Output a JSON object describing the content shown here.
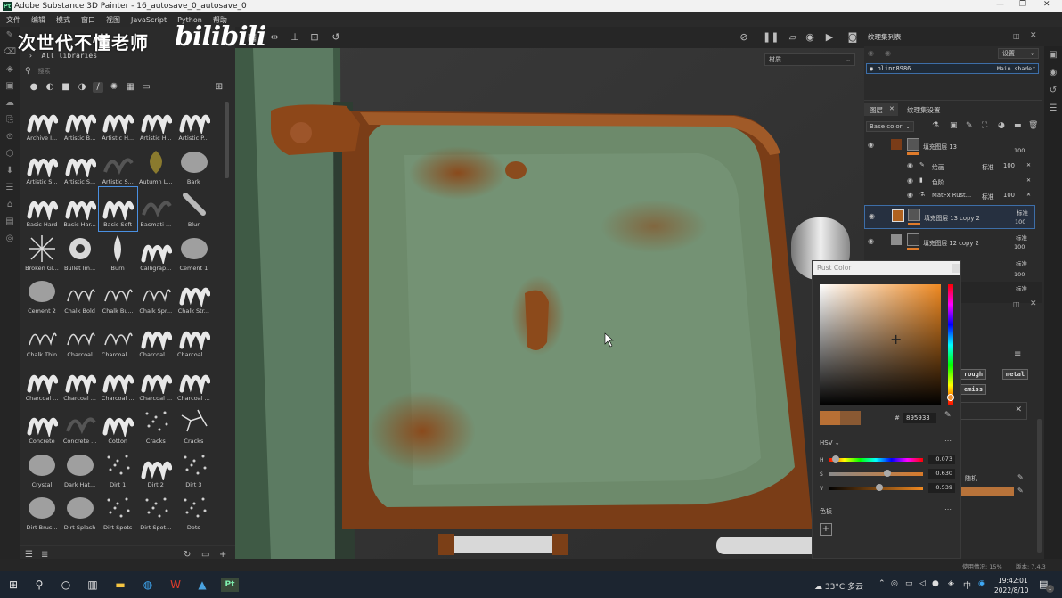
{
  "titlebar": {
    "app_icon": "Pt",
    "title": "Adobe Substance 3D Painter - 16_autosave_0_autosave_0"
  },
  "menu": [
    "文件",
    "编辑",
    "模式",
    "窗口",
    "视图",
    "JavaScript",
    "Python",
    "帮助"
  ],
  "watermark": {
    "text": "次世代不懂老师",
    "logo": "bilibili"
  },
  "shelf": {
    "library": "All libraries",
    "search_placeholder": "搜索",
    "brushes": [
      "Archive I...",
      "Artistic B...",
      "Artistic H...",
      "Artistic H...",
      "Artistic P...",
      "Artistic S...",
      "Artistic S...",
      "Artistic S...",
      "Autumn L...",
      "Bark",
      "Basic Hard",
      "Basic Har...",
      "Basic Soft",
      "Basmati ...",
      "Blur",
      "Broken Gl...",
      "Bullet Im...",
      "Burn",
      "Calligrap...",
      "Cement 1",
      "Cement 2",
      "Chalk Bold",
      "Chalk Bu...",
      "Chalk Spr...",
      "Chalk Str...",
      "Chalk Thin",
      "Charcoal",
      "Charcoal ...",
      "Charcoal ...",
      "Charcoal ...",
      "Charcoal ...",
      "Charcoal ...",
      "Charcoal ...",
      "Charcoal ...",
      "Charcoal ...",
      "Concrete",
      "Concrete ...",
      "Cotton",
      "Cracks",
      "Cracks",
      "Crystal",
      "Dark Hat...",
      "Dirt 1",
      "Dirt 2",
      "Dirt 3",
      "Dirt Brus...",
      "Dirt Splash",
      "Dirt Spots",
      "Dirt Spot...",
      "Dots"
    ],
    "selected_brush": "Basic Soft"
  },
  "viewport": {
    "material_select": "材质"
  },
  "texture_set_list": {
    "title": "纹理集列表",
    "settings_label": "设置",
    "shader_name": "blinn8986",
    "shader_type": "Main shader"
  },
  "layer_tabs": {
    "layers": "图层",
    "texture_set_settings": "纹理集设置",
    "channel": "Base color"
  },
  "layers": [
    {
      "name": "填充图层 13",
      "opacity": "100"
    },
    {
      "name": "绘画",
      "blend": "标准",
      "opacity": "100"
    },
    {
      "name": "色阶",
      "blend": "",
      "opacity": ""
    },
    {
      "name": "MatFx Rust...",
      "blend": "标准",
      "opacity": "100"
    },
    {
      "name": "填充图层 13 copy 2",
      "blend": "标准",
      "opacity": "100"
    },
    {
      "name": "填充图层 12 copy 2",
      "blend": "标准",
      "opacity": "100"
    },
    {
      "name": "",
      "blend": "标准",
      "opacity": "100"
    },
    {
      "name": "",
      "blend": "标准",
      "opacity": ""
    }
  ],
  "properties": {
    "tag_roughness": "rough",
    "tag_metal": "metal",
    "tag_emissive": "emiss",
    "random_label": "随机"
  },
  "color_picker": {
    "title": "Rust Color",
    "hex_label": "#",
    "hex_value": "895933",
    "mode": "HSV",
    "h_label": "H",
    "h_value": "0.073",
    "s_label": "S",
    "s_value": "0.630",
    "v_label": "V",
    "v_value": "0.539",
    "palette_label": "色板",
    "swatch_new": "#b87035",
    "swatch_old": "#895933"
  },
  "statusbar": {
    "memory": "使用情况: 15%",
    "version": "版本: 7.4.3"
  },
  "taskbar": {
    "weather": "33°C 多云",
    "ime": "中",
    "time": "19:42:01",
    "date": "2022/8/10",
    "badge": "1"
  }
}
